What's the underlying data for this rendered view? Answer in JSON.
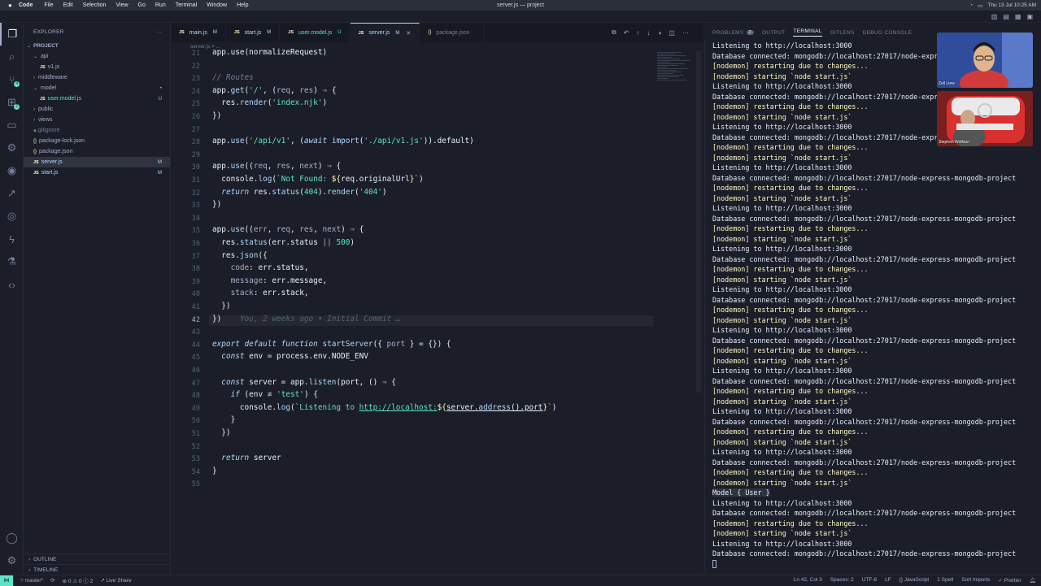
{
  "menubar": {
    "app": "Code",
    "menus": [
      "File",
      "Edit",
      "Selection",
      "View",
      "Go",
      "Run",
      "Terminal",
      "Window",
      "Help"
    ],
    "title": "server.js — project",
    "clock": "Thu 13 Jul 10:25 AM"
  },
  "sidebar": {
    "title": "EXPLORER",
    "section": "PROJECT",
    "items": [
      {
        "label": "api",
        "kind": "folder",
        "open": true,
        "depth": 1,
        "status": ""
      },
      {
        "label": "v1.js",
        "kind": "js",
        "depth": 2,
        "status": ""
      },
      {
        "label": "middleware",
        "kind": "folder",
        "open": false,
        "depth": 1,
        "status": ""
      },
      {
        "label": "model",
        "kind": "folder",
        "open": true,
        "depth": 1,
        "status": "•"
      },
      {
        "label": "user.model.js",
        "kind": "js",
        "depth": 2,
        "status": "U"
      },
      {
        "label": "public",
        "kind": "folder",
        "open": false,
        "depth": 1,
        "status": ""
      },
      {
        "label": "views",
        "kind": "folder",
        "open": false,
        "depth": 1,
        "status": ""
      },
      {
        "label": ".gitignore",
        "kind": "ignore",
        "depth": 1,
        "status": ""
      },
      {
        "label": "package-lock.json",
        "kind": "json",
        "depth": 1,
        "status": ""
      },
      {
        "label": "package.json",
        "kind": "json",
        "depth": 1,
        "status": ""
      },
      {
        "label": "server.js",
        "kind": "js",
        "depth": 1,
        "status": "M",
        "selected": true
      },
      {
        "label": "start.js",
        "kind": "js",
        "depth": 1,
        "status": "M"
      }
    ],
    "outline": "OUTLINE",
    "timeline": "TIMELINE"
  },
  "tabs": [
    {
      "label": "main.js",
      "flag": "M",
      "icon": "JS"
    },
    {
      "label": "start.js",
      "flag": "M",
      "icon": "JS"
    },
    {
      "label": "user.model.js",
      "flag": "U",
      "icon": "JS"
    },
    {
      "label": "server.js",
      "flag": "M",
      "icon": "JS",
      "active": true
    },
    {
      "label": "package.json",
      "flag": "",
      "icon": "{}"
    }
  ],
  "breadcrumb": "server.js > ...",
  "code": {
    "lines": [
      {
        "n": "21",
        "html": "app.use(normalizeRequest)"
      },
      {
        "n": "22",
        "html": ""
      },
      {
        "n": "23",
        "html": "<span class='c-cm'>// Routes</span>"
      },
      {
        "n": "24",
        "html": "app.<span class='c-fn'>get</span>(<span class='c-str'>'/'</span>, (<span class='c-pl'>req</span>, <span class='c-pl'>res</span>) <span class='c-pl'>⇒</span> {"
      },
      {
        "n": "25",
        "html": "  res.<span class='c-fn'>render</span>(<span class='c-str'>'index.njk'</span>)"
      },
      {
        "n": "26",
        "html": "})"
      },
      {
        "n": "27",
        "html": ""
      },
      {
        "n": "28",
        "html": "app.<span class='c-fn'>use</span>(<span class='c-str'>'/api/v1'</span>, (<span class='c-kw'>await</span> <span class='c-fn'>import</span>(<span class='c-str'>'./api/v1.js'</span>)).default)"
      },
      {
        "n": "29",
        "html": ""
      },
      {
        "n": "30",
        "html": "app.<span class='c-fn'>use</span>((<span class='c-pl'>req</span>, <span class='c-pl'>res</span>, <span class='c-pl'>next</span>) <span class='c-pl'>⇒</span> {"
      },
      {
        "n": "31",
        "html": "  console.<span class='c-fn'>log</span>(<span class='c-str'>`Not Found: </span><span class='c-bl'>${</span>req.originalUrl<span class='c-bl'>}</span><span class='c-str'>`</span>)"
      },
      {
        "n": "32",
        "html": "  <span class='c-kw'>return</span> res.<span class='c-fn'>status</span>(<span class='c-num'>404</span>).<span class='c-fn'>render</span>(<span class='c-str'>'404'</span>)"
      },
      {
        "n": "33",
        "html": "})"
      },
      {
        "n": "34",
        "html": ""
      },
      {
        "n": "35",
        "html": "app.<span class='c-fn'>use</span>((<span class='c-pl'>err</span>, <span class='c-pl'>req</span>, <span class='c-pl'>res</span>, <span class='c-pl'>next</span>) <span class='c-pl'>⇒</span> {"
      },
      {
        "n": "36",
        "html": "  res.<span class='c-fn'>status</span>(err.status <span class='c-pl'>||</span> <span class='c-num'>500</span>)"
      },
      {
        "n": "37",
        "html": "  res.<span class='c-fn'>json</span>({"
      },
      {
        "n": "38",
        "html": "    <span class='c-pl'>code</span>: err.status,"
      },
      {
        "n": "39",
        "html": "    <span class='c-pl'>message</span>: err.message,"
      },
      {
        "n": "40",
        "html": "    <span class='c-pl'>stack</span>: err.stack,"
      },
      {
        "n": "41",
        "html": "  })"
      },
      {
        "n": "42",
        "html": "})    <span class='blame'>You, 2 weeks ago • Initial Commit …</span>",
        "current": true
      },
      {
        "n": "43",
        "html": ""
      },
      {
        "n": "44",
        "html": "<span class='c-kw'>export default function</span> <span class='c-fn'>startServer</span>({ <span class='c-pl'>port</span> } = {}) {"
      },
      {
        "n": "45",
        "html": "  <span class='c-kw'>const</span> env = process.env.NODE_ENV"
      },
      {
        "n": "46",
        "html": ""
      },
      {
        "n": "47",
        "html": "  <span class='c-kw'>const</span> server = app.<span class='c-fn'>listen</span>(port, () <span class='c-pl'>⇒</span> {"
      },
      {
        "n": "48",
        "html": "    <span class='c-kw'>if</span> (env <span class='c-pl'>≢</span> <span class='c-str'>'test'</span>) {"
      },
      {
        "n": "49",
        "html": "      console.<span class='c-fn'>log</span>(<span class='c-str'>`Listening to <u>http://localhost:</u></span><span class='c-bl'>${</span><u>server.<span class='c-fn'>address</span>().port</u><span class='c-bl'>}</span><span class='c-str'>`</span>)"
      },
      {
        "n": "50",
        "html": "    }"
      },
      {
        "n": "51",
        "html": "  })"
      },
      {
        "n": "52",
        "html": ""
      },
      {
        "n": "53",
        "html": "  <span class='c-kw'>return</span> server"
      },
      {
        "n": "54",
        "html": "}"
      },
      {
        "n": "55",
        "html": ""
      }
    ]
  },
  "panel": {
    "tabs": [
      "PROBLEMS",
      "OUTPUT",
      "TERMINAL",
      "GITLENS",
      "DEBUG CONSOLE"
    ],
    "problems_count": "2",
    "active": "TERMINAL"
  },
  "terminal": {
    "lines": [
      {
        "t": "Listening to http://localhost:3000"
      },
      {
        "t": "Database connected: mongodb://localhost:27017/node-express-mongodb-project"
      },
      {
        "t": "[nodemon] restarting due to changes...",
        "y": true
      },
      {
        "t": "[nodemon] starting `node start.js`",
        "y": true
      },
      {
        "t": "Listening to http://localhost:3000"
      },
      {
        "t": "Database connected: mongodb://localhost:27017/node-express-mongodb-project"
      },
      {
        "t": "[nodemon] restarting due to changes...",
        "y": true
      },
      {
        "t": "[nodemon] starting `node start.js`",
        "y": true
      },
      {
        "t": "Listening to http://localhost:3000"
      },
      {
        "t": "Database connected: mongodb://localhost:27017/node-express-mongodb-project"
      },
      {
        "t": "[nodemon] restarting due to changes...",
        "y": true
      },
      {
        "t": "[nodemon] starting `node start.js`",
        "y": true
      },
      {
        "t": "Listening to http://localhost:3000"
      },
      {
        "t": "Database connected: mongodb://localhost:27017/node-express-mongodb-project"
      },
      {
        "t": "[nodemon] restarting due to changes...",
        "y": true
      },
      {
        "t": "[nodemon] starting `node start.js`",
        "y": true
      },
      {
        "t": "Listening to http://localhost:3000"
      },
      {
        "t": "Database connected: mongodb://localhost:27017/node-express-mongodb-project"
      },
      {
        "t": "[nodemon] restarting due to changes...",
        "y": true
      },
      {
        "t": "[nodemon] starting `node start.js`",
        "y": true
      },
      {
        "t": "Listening to http://localhost:3000"
      },
      {
        "t": "Database connected: mongodb://localhost:27017/node-express-mongodb-project"
      },
      {
        "t": "[nodemon] restarting due to changes...",
        "y": true
      },
      {
        "t": "[nodemon] starting `node start.js`",
        "y": true
      },
      {
        "t": "Listening to http://localhost:3000"
      },
      {
        "t": "Database connected: mongodb://localhost:27017/node-express-mongodb-project"
      },
      {
        "t": "[nodemon] restarting due to changes...",
        "y": true
      },
      {
        "t": "[nodemon] starting `node start.js`",
        "y": true
      },
      {
        "t": "Listening to http://localhost:3000"
      },
      {
        "t": "Database connected: mongodb://localhost:27017/node-express-mongodb-project"
      },
      {
        "t": "[nodemon] restarting due to changes...",
        "y": true
      },
      {
        "t": "[nodemon] starting `node start.js`",
        "y": true
      },
      {
        "t": "Listening to http://localhost:3000"
      },
      {
        "t": "Database connected: mongodb://localhost:27017/node-express-mongodb-project"
      },
      {
        "t": "[nodemon] restarting due to changes...",
        "y": true
      },
      {
        "t": "[nodemon] starting `node start.js`",
        "y": true
      },
      {
        "t": "Listening to http://localhost:3000"
      },
      {
        "t": "Database connected: mongodb://localhost:27017/node-express-mongodb-project"
      },
      {
        "t": "[nodemon] restarting due to changes...",
        "y": true
      },
      {
        "t": "[nodemon] starting `node start.js`",
        "y": true
      },
      {
        "t": "Listening to http://localhost:3000"
      },
      {
        "t": "Database connected: mongodb://localhost:27017/node-express-mongodb-project"
      },
      {
        "t": "[nodemon] restarting due to changes...",
        "y": true
      },
      {
        "t": "[nodemon] starting `node start.js`",
        "y": true
      },
      {
        "t": "Model { User }",
        "hl": true
      },
      {
        "t": "Listening to http://localhost:3000"
      },
      {
        "t": "Database connected: mongodb://localhost:27017/node-express-mongodb-project"
      },
      {
        "t": "[nodemon] restarting due to changes...",
        "y": true
      },
      {
        "t": "[nodemon] starting `node start.js`",
        "y": true
      },
      {
        "t": "Listening to http://localhost:3000"
      },
      {
        "t": "Database connected: mongodb://localhost:27017/node-express-mongodb-project"
      }
    ]
  },
  "webcams": [
    {
      "name": "Zell Liew"
    },
    {
      "name": "Stephen Wolfson"
    }
  ],
  "statusbar": {
    "branch": "master*",
    "problems": "⊗ 0 ⚠ 0 ⓘ 2",
    "live_share": "Live Share",
    "position": "Ln 42, Col 3",
    "spaces": "Spaces: 2",
    "encoding": "UTF-8",
    "eol": "LF",
    "language": "{} JavaScript",
    "spell": "1 Spell",
    "sort_imports": "Sort Imports",
    "prettier": "✓ Prettier"
  }
}
